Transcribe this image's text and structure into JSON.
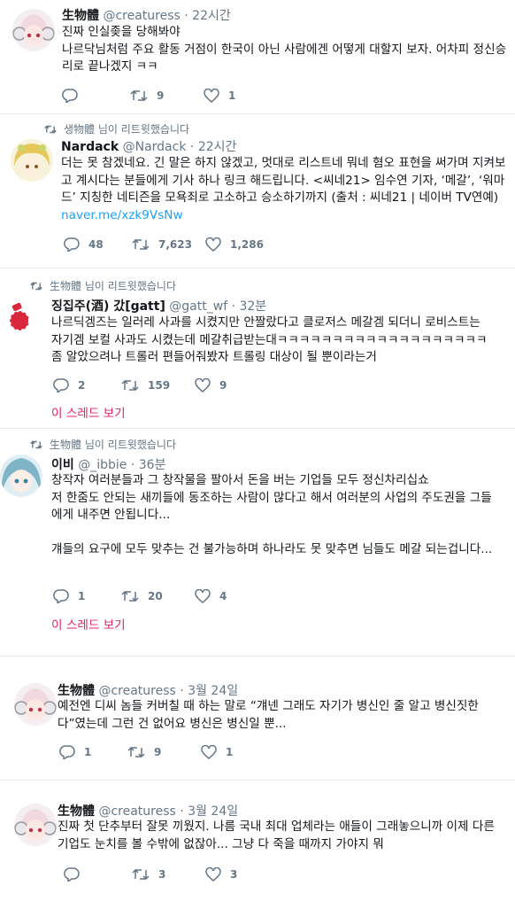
{
  "tweets": [
    {
      "name": "生物體",
      "handle": "@creaturess",
      "time": "22시간",
      "text": "진짜 인실좆을 당해봐야\n나르닥님처럼 주요 활동 거점이 한국이 아닌 사람에겐 어떻게 대할지 보자. 어차피 정신승리로 끝나겠지 ㅋㅋ",
      "replies": "",
      "retweets": "9",
      "likes": "1"
    },
    {
      "retweeted_by": "생物體 님이 리트윗했습니다",
      "name": "Nardack",
      "handle": "@Nardack",
      "time": "22시간",
      "text": "더는 못 참겠네요. 긴 말은 하지 않겠고, 멋대로 리스트네 뭐네 혐오 표현을 써가며 지켜보고 계시다는 분들에게 기사 하나 링크 해드립니다. <씨네21> 임수연 기자, ‘메갈’, ‘워마드’ 지칭한 네티즌을 모욕죄로 고소하고 승소하기까지 (출처 : 씨네21 | 네이버 TV연예) ",
      "link": "naver.me/xzk9VsNw",
      "replies": "48",
      "retweets": "7,623",
      "likes": "1,286"
    },
    {
      "retweeted_by": "生物體 님이 리트윗했습니다",
      "name": "징집주(酒) 갔[gatt]",
      "handle": "@gatt_wf",
      "time": "32분",
      "text": "나르딕겜즈는 일러레 사과를 시켰지만 안짤랐다고 클로저스 메갈겜 되더니 로비스트는 자기겜 보컬 사과도 시켰는데 메갈취급받는대ㅋㅋㅋㅋㅋㅋㅋㅋㅋㅋㅋㅋㅋㅋㅋㅋㅋㅋㅋ좀 알았으려나 트롤러 편들어줘봤자 트롤링 대상이 될 뿐이라는거",
      "replies": "2",
      "retweets": "159",
      "likes": "9",
      "show_thread": "이 스레드 보기"
    },
    {
      "retweeted_by": "生物體 님이 리트윗했습니다",
      "name": "이비",
      "handle": "@_ibbie",
      "time": "36분",
      "text": "창작자 여러분들과 그 창작물을 팔아서 돈을 버는 기업들 모두 정신차리십쇼\n저 한줌도 안되는 새끼들에 동조하는 사람이 많다고 해서 여러분의 사업의 주도권을 그들에게 내주면 안됩니다...\n\n걔들의 요구에 모두 맞추는 건 불가능하며 하나라도 못 맞추면 님들도 메갈 되는겁니다...",
      "replies": "1",
      "retweets": "20",
      "likes": "4",
      "show_thread": "이 스레드 보기"
    },
    {
      "name": "生物體",
      "handle": "@creaturess",
      "time": "3월 24일",
      "text": "예전엔 디씨 놈들 커버칠 때 하는 말로 “걔넨 그래도 자기가 병신인 줄 알고 병신짓한다”였는데 그런 건 없어요 병신은 병신일 뿐...",
      "replies": "1",
      "retweets": "9",
      "likes": "1"
    },
    {
      "name": "生物體",
      "handle": "@creaturess",
      "time": "3월 24일",
      "text": "진짜 첫 단추부터 잘못 끼웠지. 나름 국내 최대 업체라는 애들이 그래놓으니까 이제 다른 기업도 눈치를 볼 수밖에 없잖아... 그냥 다 죽을 때까지 가야지 뭐",
      "replies": "",
      "retweets": "3",
      "likes": "3"
    }
  ],
  "icons": {
    "reply": "reply-icon",
    "retweet": "retweet-icon",
    "like": "heart-icon"
  },
  "colors": {
    "link": "#1da1f2",
    "show_thread": "#e0245e",
    "meta": "#657786",
    "divider": "#e6ecf0"
  }
}
